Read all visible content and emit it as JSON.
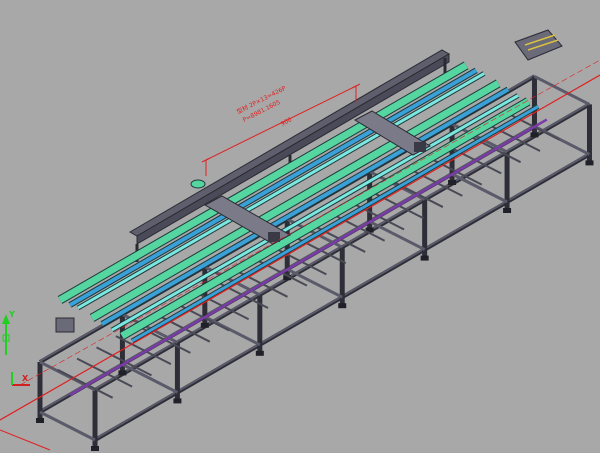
{
  "viewport": {
    "background": "#a8a8a8"
  },
  "drawing": {
    "annotation_line1": "型材 2P×13=426P",
    "annotation_line2": "P=8981.1605",
    "dimension_value": "900",
    "colors": {
      "frame": "#5a5a6a",
      "frame_dark": "#2e2e38",
      "rail_green": "#55d6a0",
      "rail_blue": "#3aa0d8",
      "rail_cyan": "#7ae8e0",
      "dimension_red": "#e02020",
      "purple": "#7a3aa8"
    }
  },
  "ucs": {
    "y_label": "Y",
    "x_label": "X",
    "icon": "ucs-axis-icon",
    "y_color": "#20d020",
    "x_color": "#d02020"
  }
}
